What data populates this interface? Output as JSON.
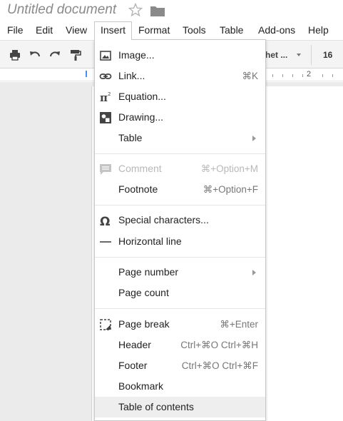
{
  "document": {
    "title": "Untitled document"
  },
  "menubar": {
    "items": [
      {
        "label": "File"
      },
      {
        "label": "Edit"
      },
      {
        "label": "View"
      },
      {
        "label": "Insert",
        "active": true
      },
      {
        "label": "Format"
      },
      {
        "label": "Tools"
      },
      {
        "label": "Table"
      },
      {
        "label": "Add-ons"
      },
      {
        "label": "Help"
      }
    ]
  },
  "toolbar": {
    "font_name": "het ...",
    "font_size": "16"
  },
  "ruler": {
    "number": "2"
  },
  "insert_menu": {
    "items": [
      {
        "label": "Image...",
        "icon": "image-icon"
      },
      {
        "label": "Link...",
        "shortcut": "⌘K",
        "icon": "link-icon"
      },
      {
        "label": "Equation...",
        "icon": "equation-icon"
      },
      {
        "label": "Drawing...",
        "icon": "drawing-icon"
      },
      {
        "label": "Table",
        "submenu": true
      },
      {
        "label": "Comment",
        "shortcut": "⌘+Option+M",
        "icon": "comment-icon",
        "disabled": true
      },
      {
        "label": "Footnote",
        "shortcut": "⌘+Option+F"
      },
      {
        "label": "Special characters...",
        "icon": "omega-icon"
      },
      {
        "label": "Horizontal line",
        "icon": "horizontal-line-icon"
      },
      {
        "label": "Page number",
        "submenu": true
      },
      {
        "label": "Page count"
      },
      {
        "label": "Page break",
        "shortcut": "⌘+Enter",
        "icon": "page-break-icon"
      },
      {
        "label": "Header",
        "shortcut": "Ctrl+⌘O Ctrl+⌘H"
      },
      {
        "label": "Footer",
        "shortcut": "Ctrl+⌘O Ctrl+⌘F"
      },
      {
        "label": "Bookmark"
      },
      {
        "label": "Table of contents",
        "highlighted": true
      }
    ]
  },
  "colors": {
    "highlight": "#eeeeee",
    "disabled_text": "#b8b8b8",
    "ruler_marker": "#4a8af4"
  }
}
